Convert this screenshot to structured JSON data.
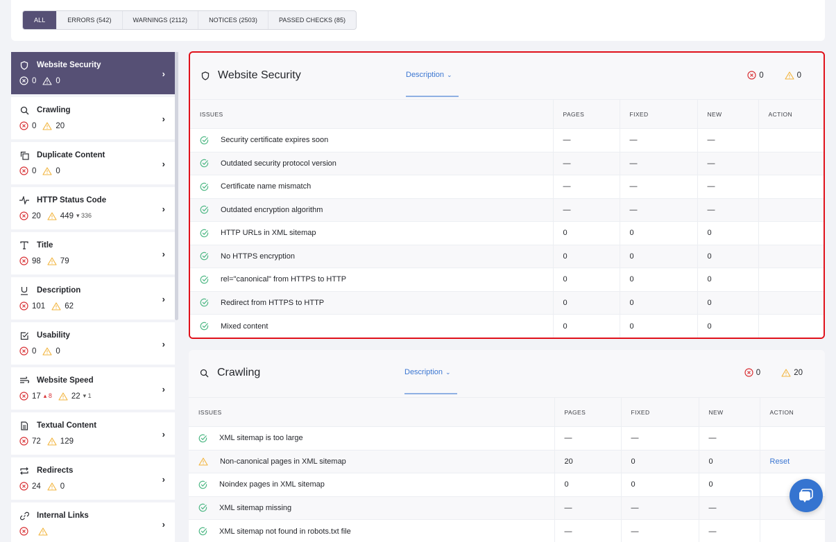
{
  "filters": [
    {
      "label": "ALL",
      "active": true
    },
    {
      "label": "ERRORS (542)"
    },
    {
      "label": "WARNINGS (2112)"
    },
    {
      "label": "NOTICES (2503)"
    },
    {
      "label": "PASSED CHECKS (85)"
    }
  ],
  "colors": {
    "accent": "#565075",
    "error": "#d93438",
    "warning": "#f2b43c",
    "pass": "#4cb783",
    "link": "#3b76d1"
  },
  "sidebar": [
    {
      "icon": "shield-icon",
      "label": "Website Security",
      "errors": "0",
      "warnings": "0",
      "active": true
    },
    {
      "icon": "search-icon",
      "label": "Crawling",
      "errors": "0",
      "warnings": "20"
    },
    {
      "icon": "duplicate-icon",
      "label": "Duplicate Content",
      "errors": "0",
      "warnings": "0"
    },
    {
      "icon": "pulse-icon",
      "label": "HTTP Status Code",
      "errors": "20",
      "warnings": "449",
      "warnings_delta": "▾ 336"
    },
    {
      "icon": "text-icon",
      "label": "Title",
      "errors": "98",
      "warnings": "79"
    },
    {
      "icon": "underline-icon",
      "label": "Description",
      "errors": "101",
      "warnings": "62"
    },
    {
      "icon": "checkbox-icon",
      "label": "Usability",
      "errors": "0",
      "warnings": "0"
    },
    {
      "icon": "speed-icon",
      "label": "Website Speed",
      "errors": "17",
      "errors_delta": "▴ 8",
      "warnings": "22",
      "warnings_delta": "▾ 1"
    },
    {
      "icon": "document-icon",
      "label": "Textual Content",
      "errors": "72",
      "warnings": "129"
    },
    {
      "icon": "redirect-icon",
      "label": "Redirects",
      "errors": "24",
      "warnings": "0"
    },
    {
      "icon": "link-icon",
      "label": "Internal Links",
      "errors": "",
      "warnings": ""
    }
  ],
  "table_headers": {
    "issues": "ISSUES",
    "pages": "PAGES",
    "fixed": "FIXED",
    "new": "NEW",
    "action": "ACTION"
  },
  "sections": {
    "security": {
      "title": "Website Security",
      "description_label": "Description",
      "errors": "0",
      "warnings": "0",
      "rows": [
        {
          "status": "pass",
          "issue": "Security certificate expires soon",
          "pages": "—",
          "fixed": "—",
          "new": "—",
          "action": ""
        },
        {
          "status": "pass",
          "issue": "Outdated security protocol version",
          "pages": "—",
          "fixed": "—",
          "new": "—",
          "action": ""
        },
        {
          "status": "pass",
          "issue": "Certificate name mismatch",
          "pages": "—",
          "fixed": "—",
          "new": "—",
          "action": ""
        },
        {
          "status": "pass",
          "issue": "Outdated encryption algorithm",
          "pages": "—",
          "fixed": "—",
          "new": "—",
          "action": ""
        },
        {
          "status": "pass",
          "issue": "HTTP URLs in XML sitemap",
          "pages": "0",
          "fixed": "0",
          "new": "0",
          "action": ""
        },
        {
          "status": "pass",
          "issue": "No HTTPS encryption",
          "pages": "0",
          "fixed": "0",
          "new": "0",
          "action": ""
        },
        {
          "status": "pass",
          "issue": "rel=\"canonical\" from HTTPS to HTTP",
          "pages": "0",
          "fixed": "0",
          "new": "0",
          "action": ""
        },
        {
          "status": "pass",
          "issue": "Redirect from HTTPS to HTTP",
          "pages": "0",
          "fixed": "0",
          "new": "0",
          "action": ""
        },
        {
          "status": "pass",
          "issue": "Mixed content",
          "pages": "0",
          "fixed": "0",
          "new": "0",
          "action": ""
        }
      ]
    },
    "crawling": {
      "title": "Crawling",
      "description_label": "Description",
      "errors": "0",
      "warnings": "20",
      "rows": [
        {
          "status": "pass",
          "issue": "XML sitemap is too large",
          "pages": "—",
          "fixed": "—",
          "new": "—",
          "action": ""
        },
        {
          "status": "warning",
          "issue": "Non-canonical pages in XML sitemap",
          "pages": "20",
          "fixed": "0",
          "new": "0",
          "action": "Reset"
        },
        {
          "status": "pass",
          "issue": "Noindex pages in XML sitemap",
          "pages": "0",
          "fixed": "0",
          "new": "0",
          "action": ""
        },
        {
          "status": "pass",
          "issue": "XML sitemap missing",
          "pages": "—",
          "fixed": "—",
          "new": "—",
          "action": ""
        },
        {
          "status": "pass",
          "issue": "XML sitemap not found in robots.txt file",
          "pages": "—",
          "fixed": "—",
          "new": "—",
          "action": ""
        }
      ]
    }
  }
}
